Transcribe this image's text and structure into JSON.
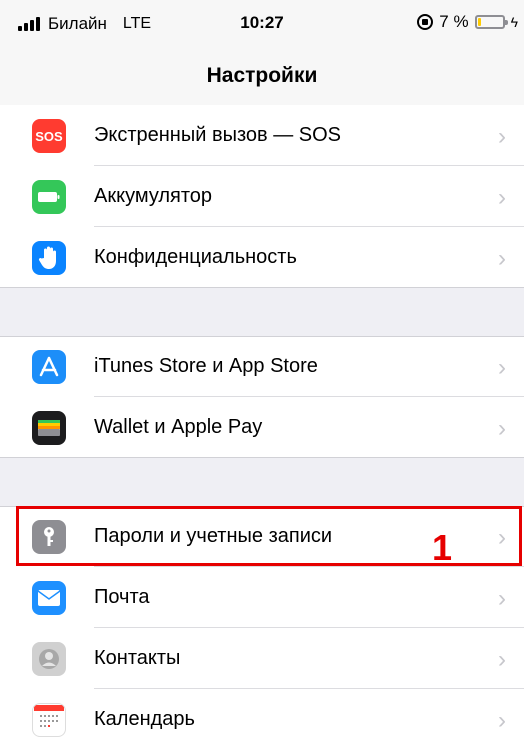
{
  "status": {
    "carrier": "Билайн",
    "network": "LTE",
    "time": "10:27",
    "battery": "7 %",
    "battery_level": 0.07
  },
  "nav": {
    "title": "Настройки"
  },
  "groups": [
    {
      "items": [
        {
          "label": "Экстренный вызов — SOS",
          "icon": "sos-icon",
          "color": "#ff3b30",
          "icon_text": "SOS"
        },
        {
          "label": "Аккумулятор",
          "icon": "battery-icon",
          "color": "#34c759"
        },
        {
          "label": "Конфиденциальность",
          "icon": "hand-icon",
          "color": "#0a84ff"
        }
      ]
    },
    {
      "items": [
        {
          "label": "iTunes Store и App Store",
          "icon": "app-store-icon",
          "color": "#1c8ef9"
        },
        {
          "label": "Wallet и Apple Pay",
          "icon": "wallet-icon",
          "color": "#1c1c1e"
        }
      ]
    },
    {
      "items": [
        {
          "label": "Пароли и учетные записи",
          "icon": "key-icon",
          "color": "#8e8e93"
        },
        {
          "label": "Почта",
          "icon": "mail-icon",
          "color": "#1e90ff"
        },
        {
          "label": "Контакты",
          "icon": "contacts-icon",
          "color": "#c8c8c8"
        },
        {
          "label": "Календарь",
          "icon": "calendar-icon",
          "color": "#ffffff"
        }
      ]
    }
  ],
  "annotation": {
    "marker": "1",
    "color": "#e60000"
  },
  "chevron": "›"
}
